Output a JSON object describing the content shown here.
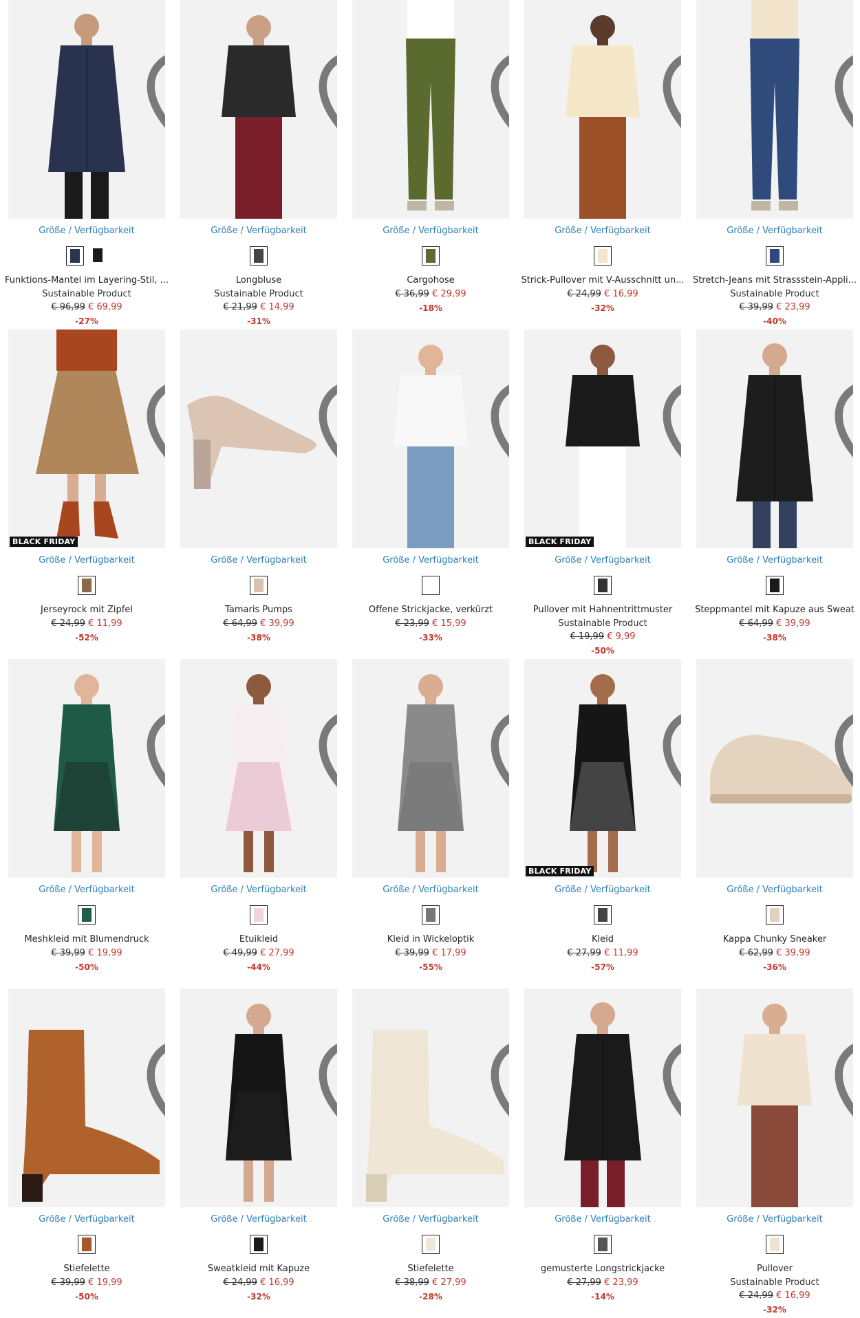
{
  "size_label": "Größe / Verfügbarkeit",
  "badge_label": "BLACK FRIDAY",
  "colors": {
    "link": "#2b7fb8",
    "sale": "#c0392b"
  },
  "products": [
    {
      "name": "Funktions-Mantel im Layering-Stil, ...",
      "sub": "Sustainable Product",
      "old": "€ 96,99",
      "new": "€ 69,99",
      "disc": "-27%",
      "badge": false,
      "swatches": [
        "#2b3550",
        "#1a1a1a"
      ],
      "img": {
        "bg": "#f1f1f1",
        "main": "#29324f",
        "acc": "#1a1a1a",
        "skin": "#c89a7c",
        "kind": "coat"
      }
    },
    {
      "name": "Longbluse",
      "sub": "Sustainable Product",
      "old": "€ 21,99",
      "new": "€ 14,99",
      "disc": "-31%",
      "badge": false,
      "swatches": [
        "#444444"
      ],
      "img": {
        "bg": "#f3f3f3",
        "main": "#2a2a2a",
        "acc": "#7a1f2a",
        "skin": "#c9a085",
        "kind": "top"
      }
    },
    {
      "name": "Cargohose",
      "sub": "",
      "old": "€ 36,99",
      "new": "€ 29,99",
      "disc": "-18%",
      "badge": false,
      "swatches": [
        "#5c6b32"
      ],
      "img": {
        "bg": "#f2f2f2",
        "main": "#5b6a2f",
        "acc": "#ffffff",
        "skin": "#d4a98f",
        "kind": "pants"
      }
    },
    {
      "name": "Strick-Pullover mit V-Ausschnitt un...",
      "sub": "",
      "old": "€ 24,99",
      "new": "€ 16,99",
      "disc": "-32%",
      "badge": false,
      "swatches": [
        "#f3e7c9"
      ],
      "img": {
        "bg": "#f2f2f2",
        "main": "#f4e8c8",
        "acc": "#9c5028",
        "skin": "#5b3c2c",
        "kind": "top"
      }
    },
    {
      "name": "Stretch-Jeans mit Strassstein-Appli...",
      "sub": "Sustainable Product",
      "old": "€ 39,99",
      "new": "€ 23,99",
      "disc": "-40%",
      "badge": false,
      "swatches": [
        "#2f4a78"
      ],
      "img": {
        "bg": "#f2f2f2",
        "main": "#2f4b7c",
        "acc": "#f3e4cc",
        "skin": "#e0b59a",
        "kind": "pants"
      }
    },
    {
      "name": "Jerseyrock mit Zipfel",
      "sub": "",
      "old": "€ 24,99",
      "new": "€ 11,99",
      "disc": "-52%",
      "badge": true,
      "swatches": [
        "#8b6a4a"
      ],
      "img": {
        "bg": "#f2f2f2",
        "main": "#b0875a",
        "acc": "#a8461f",
        "skin": "#d9ad92",
        "kind": "skirt"
      }
    },
    {
      "name": "Tamaris Pumps",
      "sub": "",
      "old": "€ 64,99",
      "new": "€ 39,99",
      "disc": "-38%",
      "badge": false,
      "swatches": [
        "#d9c3b0"
      ],
      "img": {
        "bg": "#f4f4f4",
        "main": "#dcc4b5",
        "acc": "#b9a498",
        "skin": "#dcc4b5",
        "kind": "pump"
      }
    },
    {
      "name": "Offene Strickjacke, verkürzt",
      "sub": "",
      "old": "€ 23,99",
      "new": "€ 15,99",
      "disc": "-33%",
      "badge": false,
      "swatches": [
        "#ffffff"
      ],
      "img": {
        "bg": "#f2f2f2",
        "main": "#f8f8f8",
        "acc": "#7a9cc0",
        "skin": "#e0b59a",
        "kind": "top"
      }
    },
    {
      "name": "Pullover mit Hahnentrittmuster",
      "sub": "Sustainable Product",
      "old": "€ 19,99",
      "new": "€ 9,99",
      "disc": "-50%",
      "badge": true,
      "swatches": [
        "#333333"
      ],
      "img": {
        "bg": "#f2f2f2",
        "main": "#1a1a1a",
        "acc": "#ffffff",
        "skin": "#8d5a3f",
        "kind": "top"
      }
    },
    {
      "name": "Steppmantel mit Kapuze aus Sweat",
      "sub": "",
      "old": "€ 64,99",
      "new": "€ 39,99",
      "disc": "-38%",
      "badge": false,
      "swatches": [
        "#1a1a1a"
      ],
      "img": {
        "bg": "#f2f2f2",
        "main": "#1d1d1d",
        "acc": "#33415f",
        "skin": "#d4a98f",
        "kind": "coat"
      }
    },
    {
      "name": "Meshkleid mit Blumendruck",
      "sub": "",
      "old": "€ 39,99",
      "new": "€ 19,99",
      "disc": "-50%",
      "badge": false,
      "swatches": [
        "#1f5f4a"
      ],
      "img": {
        "bg": "#f2f2f2",
        "main": "#1f5a46",
        "acc": "#1a1a1a",
        "skin": "#e0b59a",
        "kind": "dress"
      }
    },
    {
      "name": "Etuikleid",
      "sub": "",
      "old": "€ 49,99",
      "new": "€ 27,99",
      "disc": "-44%",
      "badge": false,
      "swatches": [
        "#f0d6dc"
      ],
      "img": {
        "bg": "#f2f2f2",
        "main": "#f6eef0",
        "acc": "#d88aa6",
        "skin": "#8d5a3f",
        "kind": "dress"
      }
    },
    {
      "name": "Kleid in Wickeloptik",
      "sub": "",
      "old": "€ 39,99",
      "new": "€ 17,99",
      "disc": "-55%",
      "badge": false,
      "swatches": [
        "#777777"
      ],
      "img": {
        "bg": "#f2f2f2",
        "main": "#8a8a8a",
        "acc": "#5f5f5f",
        "skin": "#d9ad92",
        "kind": "dress"
      }
    },
    {
      "name": "Kleid",
      "sub": "",
      "old": "€ 27,99",
      "new": "€ 11,99",
      "disc": "-57%",
      "badge": true,
      "swatches": [
        "#444444"
      ],
      "img": {
        "bg": "#f2f2f2",
        "main": "#161616",
        "acc": "#9a9a9a",
        "skin": "#a36d4c",
        "kind": "dress"
      }
    },
    {
      "name": "Kappa Chunky Sneaker",
      "sub": "",
      "old": "€ 62,99",
      "new": "€ 39,99",
      "disc": "-36%",
      "badge": false,
      "swatches": [
        "#e2d2bd"
      ],
      "img": {
        "bg": "#ffffff",
        "main": "#e4d3bf",
        "acc": "#c9b39b",
        "skin": "#e4d3bf",
        "kind": "sneaker"
      }
    },
    {
      "name": "Stiefelette",
      "sub": "",
      "old": "€ 39,99",
      "new": "€ 19,99",
      "disc": "-50%",
      "badge": false,
      "swatches": [
        "#a4582b"
      ],
      "img": {
        "bg": "#ffffff",
        "main": "#b0622c",
        "acc": "#2a1a12",
        "skin": "#b0622c",
        "kind": "boot"
      }
    },
    {
      "name": "Sweatkleid mit Kapuze",
      "sub": "",
      "old": "€ 24,99",
      "new": "€ 16,99",
      "disc": "-32%",
      "badge": false,
      "swatches": [
        "#1a1a1a"
      ],
      "img": {
        "bg": "#f2f2f2",
        "main": "#151515",
        "acc": "#2a2a2a",
        "skin": "#d4a98f",
        "kind": "dress"
      }
    },
    {
      "name": "Stiefelette",
      "sub": "",
      "old": "€ 38,99",
      "new": "€ 27,99",
      "disc": "-28%",
      "badge": false,
      "swatches": [
        "#efe7d8"
      ],
      "img": {
        "bg": "#f4f4f4",
        "main": "#efe6d6",
        "acc": "#d9cdb8",
        "skin": "#efe6d6",
        "kind": "boot"
      }
    },
    {
      "name": "gemusterte Longstrickjacke",
      "sub": "",
      "old": "€ 27,99",
      "new": "€ 23,99",
      "disc": "-14%",
      "badge": false,
      "swatches": [
        "#555555"
      ],
      "img": {
        "bg": "#f2f2f2",
        "main": "#1a1a1a",
        "acc": "#7a1f2a",
        "skin": "#d4a98f",
        "kind": "coat"
      }
    },
    {
      "name": "Pullover",
      "sub": "Sustainable Product",
      "old": "€ 24,99",
      "new": "€ 16,99",
      "disc": "-32%",
      "badge": false,
      "swatches": [
        "#efe4d2"
      ],
      "img": {
        "bg": "#f2f2f2",
        "main": "#efe3cf",
        "acc": "#8a4a3a",
        "skin": "#d9ad92",
        "kind": "top"
      }
    }
  ]
}
